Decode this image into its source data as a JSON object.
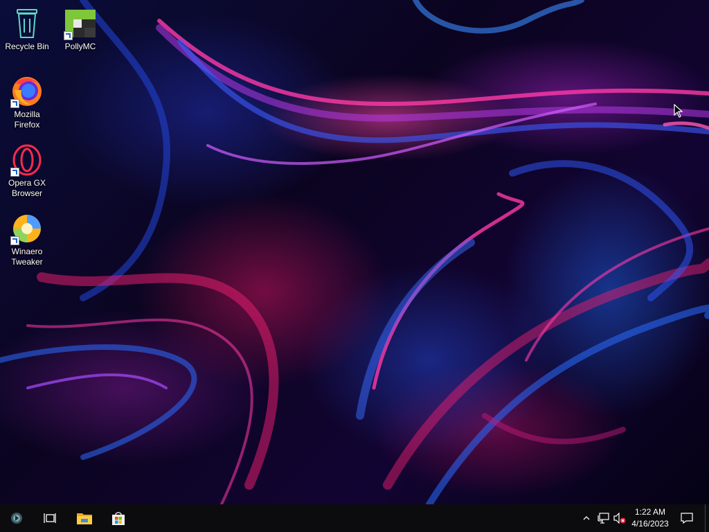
{
  "desktop": {
    "icons": [
      {
        "label": "Recycle Bin",
        "icon": "recycle-bin-icon",
        "shortcut": false
      },
      {
        "label": "PollyMC",
        "icon": "pollymc-icon",
        "shortcut": true
      },
      {
        "label": "Mozilla Firefox",
        "icon": "firefox-icon",
        "shortcut": true
      },
      {
        "label": "Opera GX Browser",
        "icon": "opera-gx-icon",
        "shortcut": true
      },
      {
        "label": "Winaero Tweaker",
        "icon": "winaero-tweaker-icon",
        "shortcut": true
      }
    ]
  },
  "taskbar": {
    "start_icon": "start-orb-icon",
    "task_view_icon": "task-view-icon",
    "pinned": [
      {
        "name": "File Explorer",
        "icon": "folder-icon"
      },
      {
        "name": "Microsoft Store",
        "icon": "store-icon"
      }
    ],
    "tray": {
      "overflow_icon": "chevron-up-icon",
      "network_icon": "network-icon",
      "volume_icon": "volume-muted-icon",
      "notification_icon": "action-center-icon"
    },
    "clock": {
      "time": "1:22 AM",
      "date": "4/16/2023"
    }
  },
  "colors": {
    "taskbar_bg": "#0c0c0f",
    "accent_pink": "#ff3aa8",
    "accent_blue": "#2a6bff"
  }
}
